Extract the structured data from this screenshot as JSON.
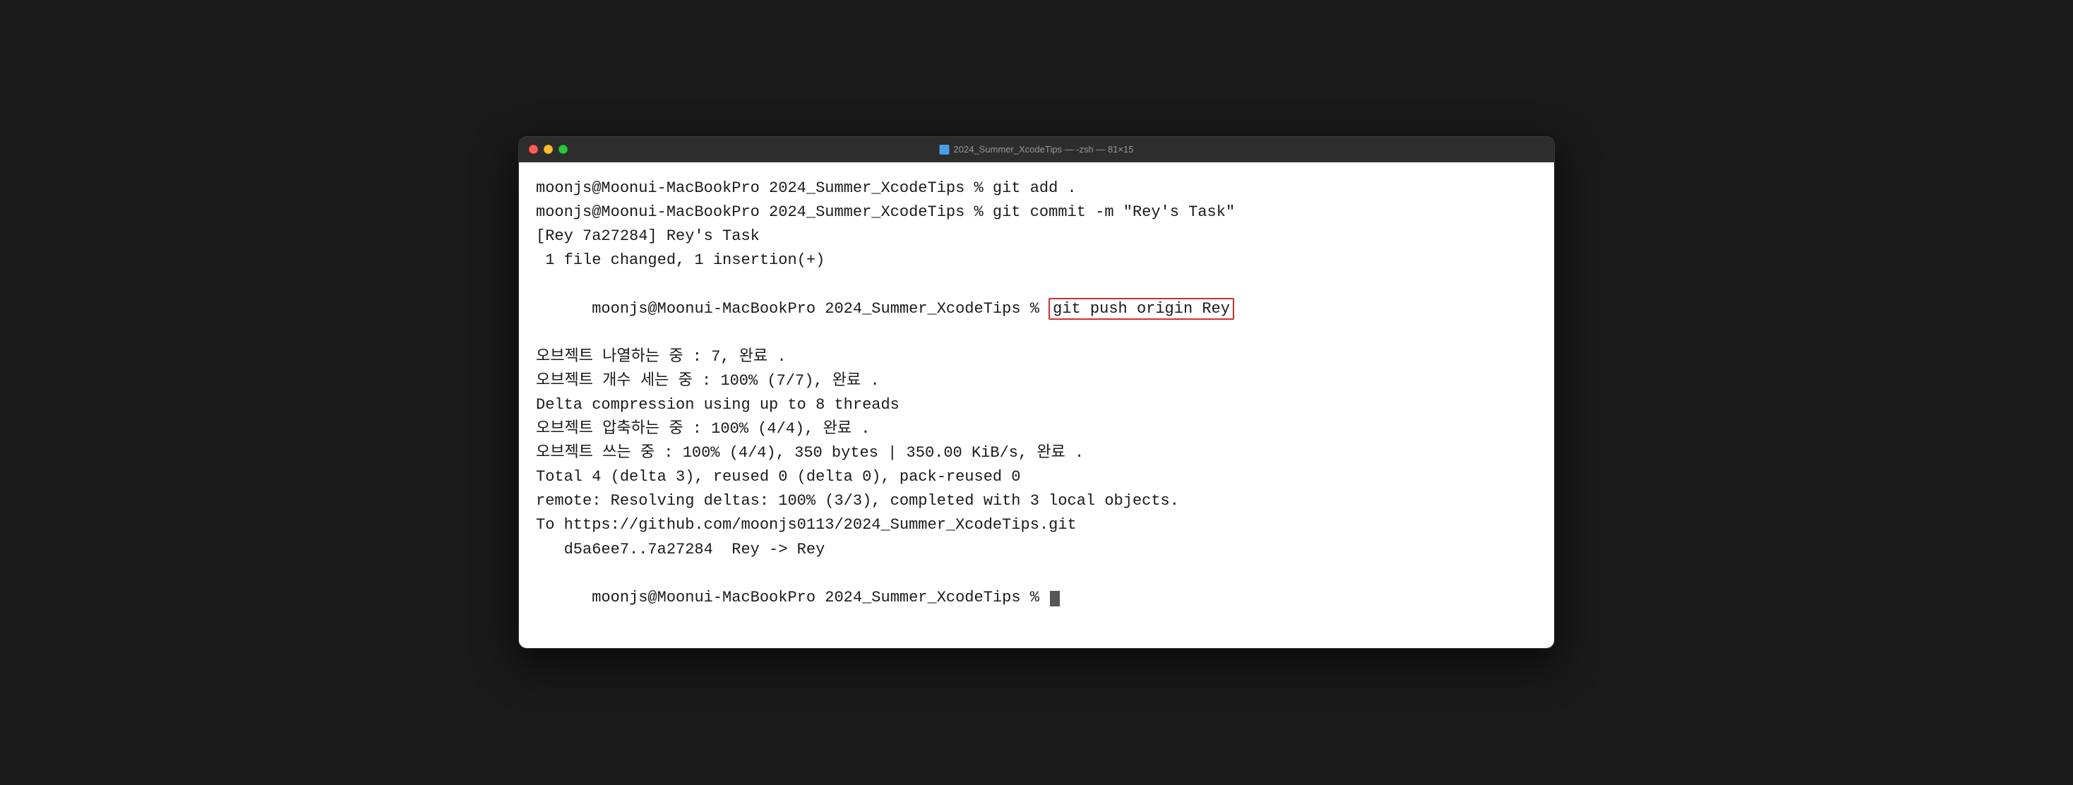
{
  "window": {
    "title": "2024_Summer_XcodeTips — -zsh — 81×15",
    "title_icon": "folder"
  },
  "terminal": {
    "lines": [
      {
        "id": "line1",
        "type": "normal",
        "text": "moonjs@Moonui-MacBookPro 2024_Summer_XcodeTips % git add ."
      },
      {
        "id": "line2",
        "type": "normal",
        "text": "moonjs@Moonui-MacBookPro 2024_Summer_XcodeTips % git commit -m \"Rey's Task\""
      },
      {
        "id": "line3",
        "type": "normal",
        "text": "[Rey 7a27284] Rey's Task"
      },
      {
        "id": "line4",
        "type": "normal",
        "text": " 1 file changed, 1 insertion(+)"
      },
      {
        "id": "line5",
        "type": "highlighted",
        "prefix": "moonjs@Moonui-MacBookPro 2024_Summer_XcodeTips % ",
        "highlighted": "git push origin Rey",
        "suffix": ""
      },
      {
        "id": "line6",
        "type": "normal",
        "text": "오브젝트 나열하는 중 : 7, 완료 ."
      },
      {
        "id": "line7",
        "type": "normal",
        "text": "오브젝트 개수 세는 중 : 100% (7/7), 완료 ."
      },
      {
        "id": "line8",
        "type": "normal",
        "text": "Delta compression using up to 8 threads"
      },
      {
        "id": "line9",
        "type": "normal",
        "text": "오브젝트 압축하는 중 : 100% (4/4), 완료 ."
      },
      {
        "id": "line10",
        "type": "normal",
        "text": "오브젝트 쓰는 중 : 100% (4/4), 350 bytes | 350.00 KiB/s, 완료 ."
      },
      {
        "id": "line11",
        "type": "normal",
        "text": "Total 4 (delta 3), reused 0 (delta 0), pack-reused 0"
      },
      {
        "id": "line12",
        "type": "normal",
        "text": "remote: Resolving deltas: 100% (3/3), completed with 3 local objects."
      },
      {
        "id": "line13",
        "type": "normal",
        "text": "To https://github.com/moonjs0113/2024_Summer_XcodeTips.git"
      },
      {
        "id": "line14",
        "type": "normal",
        "text": "   d5a6ee7..7a27284  Rey -> Rey"
      },
      {
        "id": "line15",
        "type": "prompt",
        "text": "moonjs@Moonui-MacBookPro 2024_Summer_XcodeTips % "
      }
    ]
  }
}
